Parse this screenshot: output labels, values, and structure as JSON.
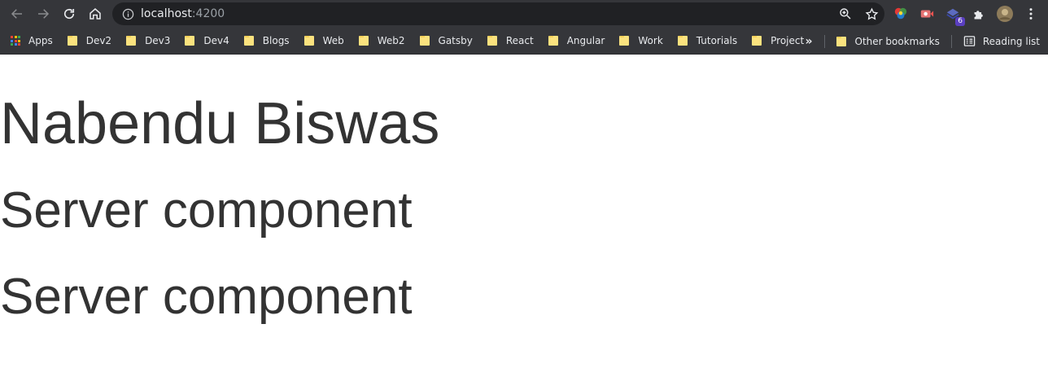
{
  "browser": {
    "url_host": "localhost",
    "url_port": ":4200",
    "extension_badge": "6"
  },
  "bookmarks": {
    "apps_label": "Apps",
    "items": [
      "Dev2",
      "Dev3",
      "Dev4",
      "Blogs",
      "Web",
      "Web2",
      "Gatsby",
      "React",
      "Angular",
      "Work",
      "Tutorials",
      "Project"
    ],
    "overflow": "»",
    "other_label": "Other bookmarks",
    "reading_list_label": "Reading list"
  },
  "page": {
    "heading": "Nabendu Biswas",
    "server_components": [
      "Server component",
      "Server component"
    ]
  },
  "colors": {
    "toolbar": "#35363a",
    "omnibox": "#202124",
    "folder": "#fbe27e",
    "text": "#333333"
  }
}
